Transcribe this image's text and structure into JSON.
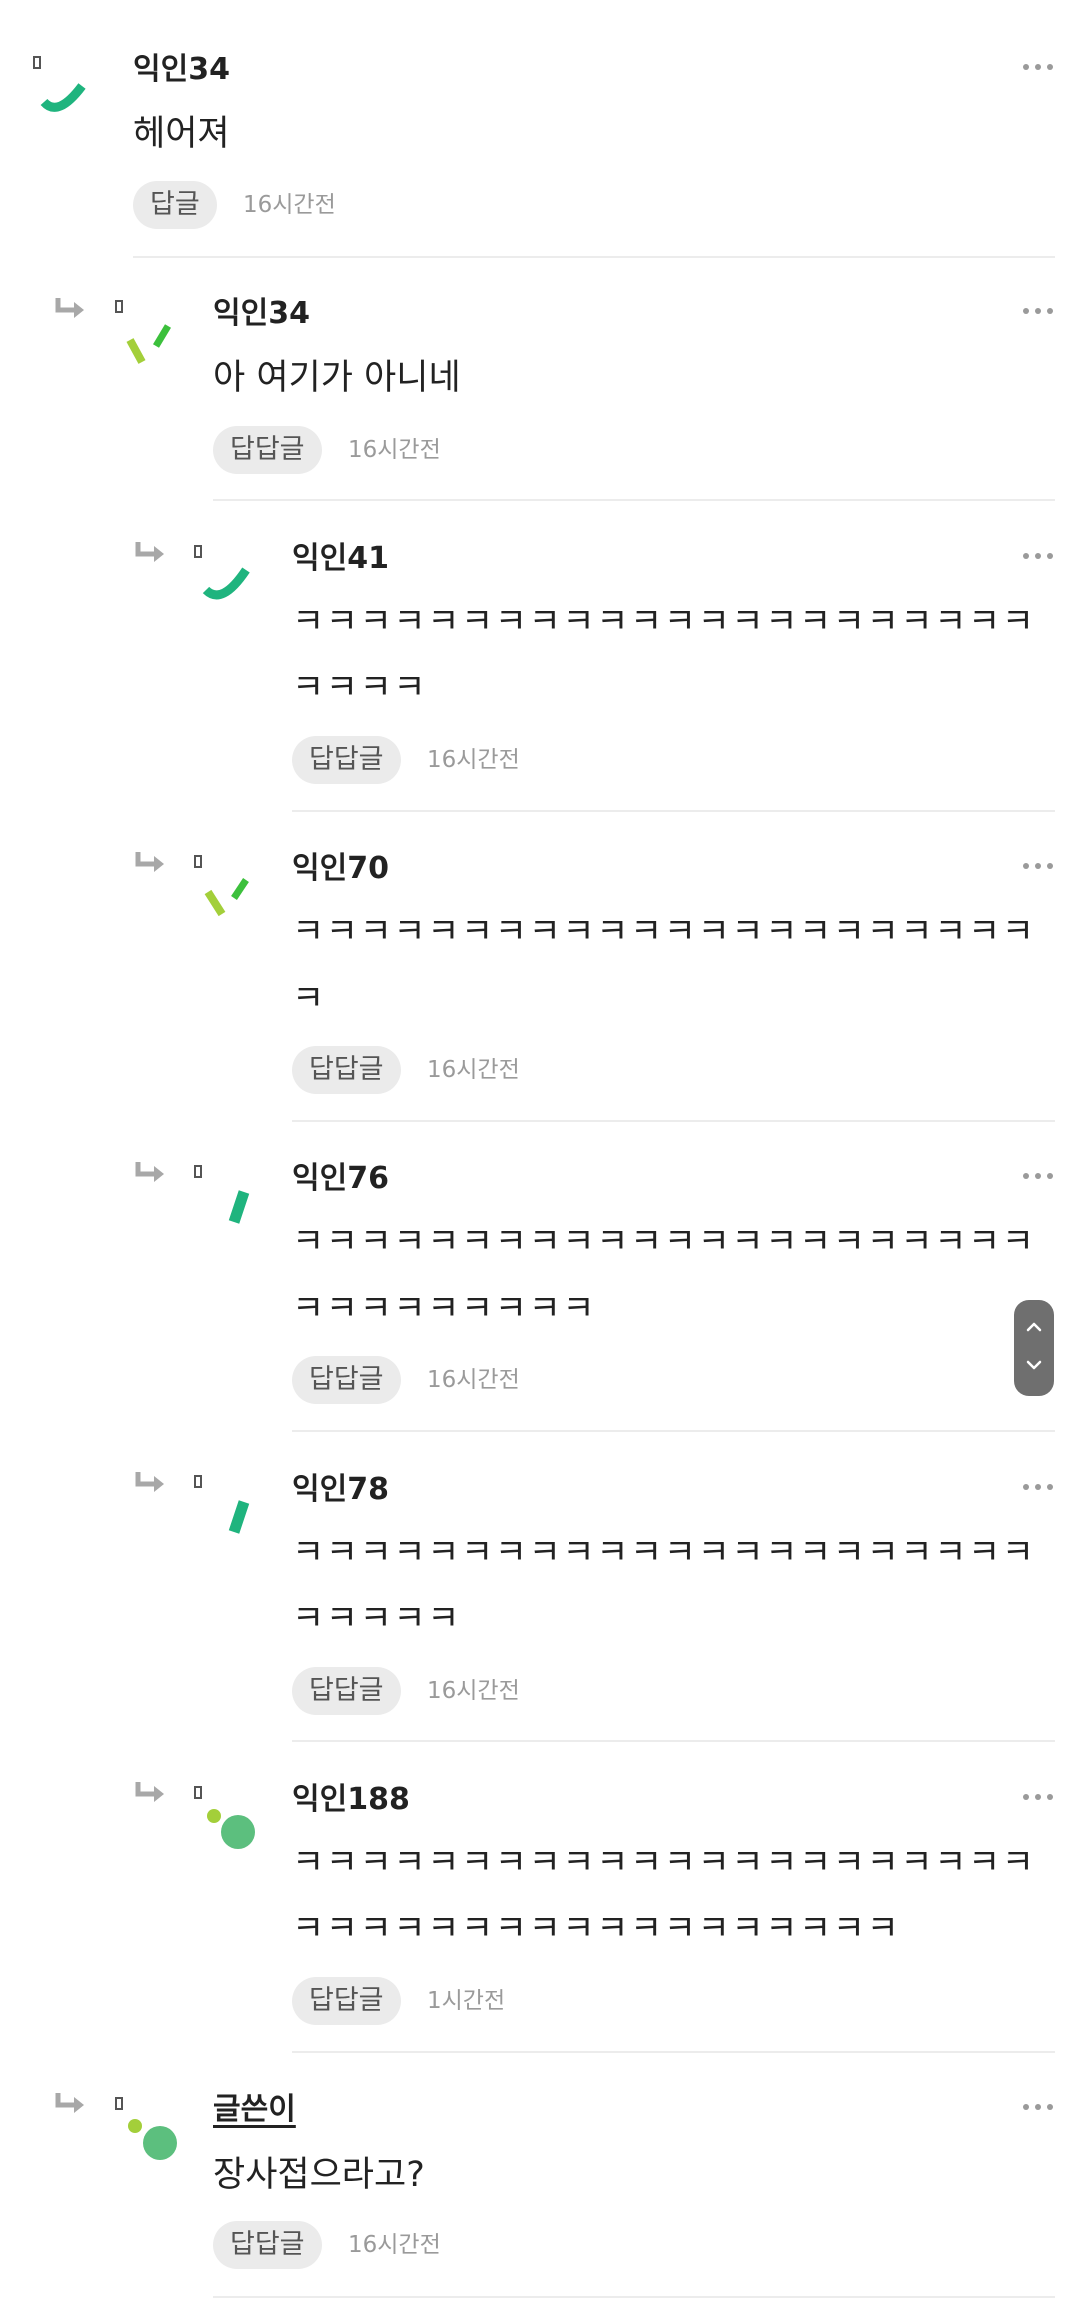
{
  "comments": [
    {
      "name": "익인34",
      "text": "헤어져",
      "reply_label": "답글",
      "time": "16시간전"
    },
    {
      "name": "익인34",
      "text": "아 여기가 아니네",
      "reply_label": "답답글",
      "time": "16시간전"
    },
    {
      "name": "익인41",
      "text_line1": "ㅋㅋㅋㅋㅋㅋㅋㅋㅋㅋㅋㅋㅋㅋㅋㅋㅋㅋㅋㅋㅋㅋ",
      "text_line2": "ㅋㅋㅋㅋ",
      "reply_label": "답답글",
      "time": "16시간전"
    },
    {
      "name": "익인70",
      "text_line1": "ㅋㅋㅋㅋㅋㅋㅋㅋㅋㅋㅋㅋㅋㅋㅋㅋㅋㅋㅋㅋㅋㅋ",
      "text_line2": "ㅋ",
      "reply_label": "답답글",
      "time": "16시간전"
    },
    {
      "name": "익인76",
      "text_line1": "ㅋㅋㅋㅋㅋㅋㅋㅋㅋㅋㅋㅋㅋㅋㅋㅋㅋㅋㅋㅋㅋㅋ",
      "text_line2": "ㅋㅋㅋㅋㅋㅋㅋㅋㅋ",
      "reply_label": "답답글",
      "time": "16시간전"
    },
    {
      "name": "익인78",
      "text_line1": "ㅋㅋㅋㅋㅋㅋㅋㅋㅋㅋㅋㅋㅋㅋㅋㅋㅋㅋㅋㅋㅋㅋ",
      "text_line2": "ㅋㅋㅋㅋㅋ",
      "reply_label": "답답글",
      "time": "16시간전"
    },
    {
      "name": "익인188",
      "text_line1": "ㅋㅋㅋㅋㅋㅋㅋㅋㅋㅋㅋㅋㅋㅋㅋㅋㅋㅋㅋㅋㅋㅋ",
      "text_line2": "ㅋㅋㅋㅋㅋㅋㅋㅋㅋㅋㅋㅋㅋㅋㅋㅋㅋㅋ",
      "reply_label": "답답글",
      "time": "1시간전"
    },
    {
      "name": "글쓴이",
      "text": "장사접으라고?",
      "reply_label": "답답글",
      "time": "16시간전"
    }
  ],
  "icons": {
    "reply_arrow": "reply-arrow-icon",
    "more": "more-options-icon",
    "scroll_up": "chevron-up-icon",
    "scroll_down": "chevron-down-icon"
  },
  "colors": {
    "avatar_teal": "#1fb47e",
    "avatar_lime": "#a3cf3a",
    "avatar_green": "#3cc03c",
    "avatar_dot_green": "#5cbf7e"
  }
}
